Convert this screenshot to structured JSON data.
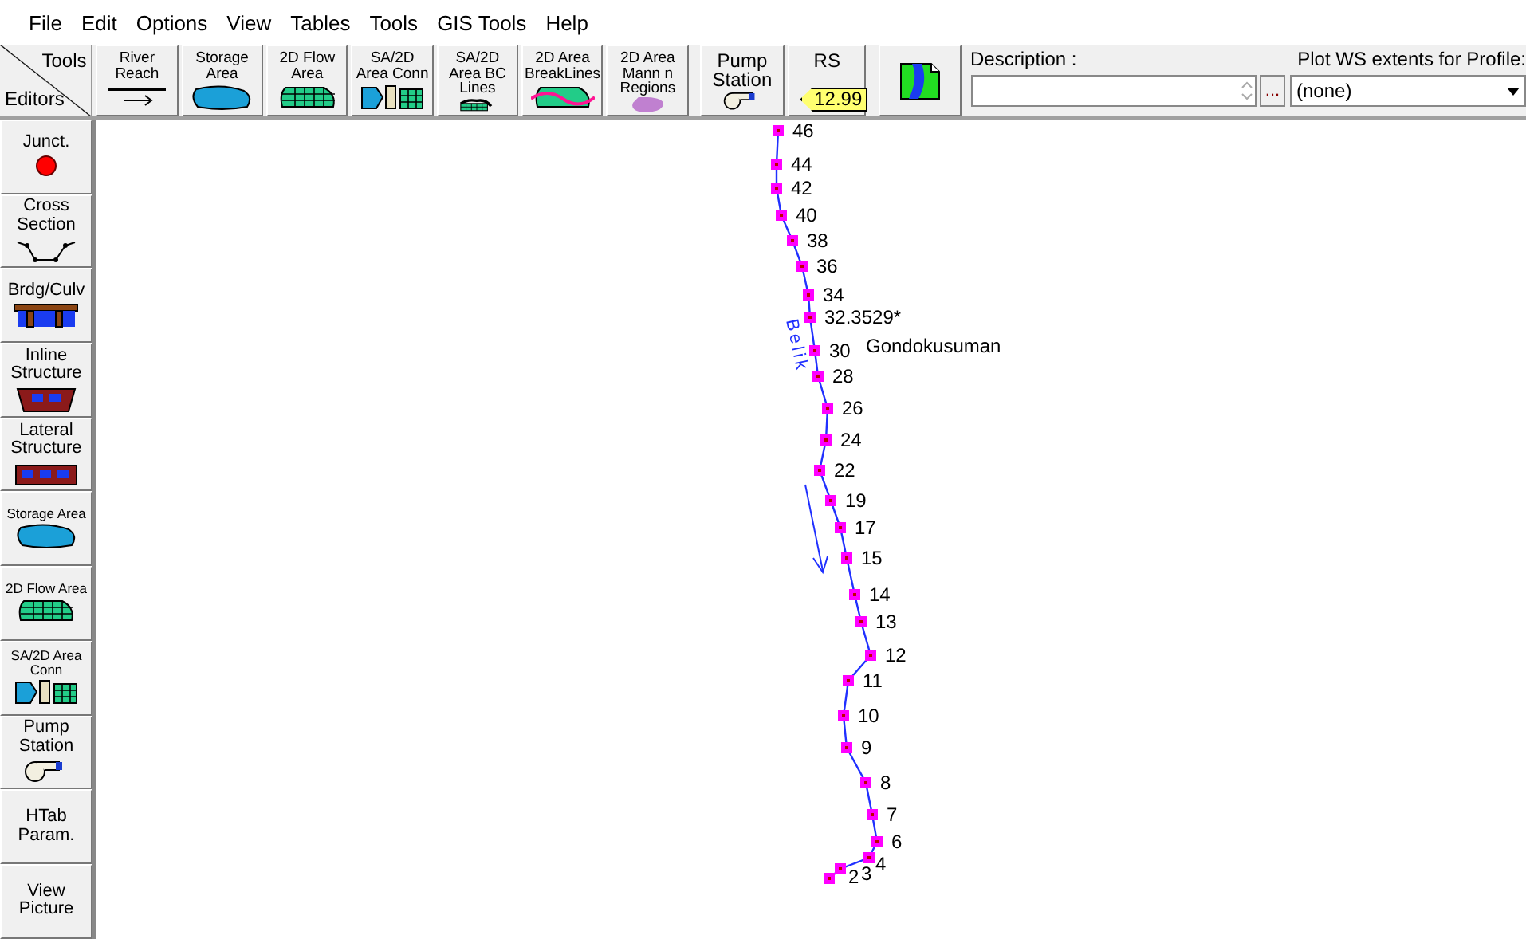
{
  "menu": [
    "File",
    "Edit",
    "Options",
    "View",
    "Tables",
    "Tools",
    "GIS Tools",
    "Help"
  ],
  "toolbar": {
    "corner_top": "Tools",
    "corner_bottom": "Editors",
    "tools": [
      {
        "label": "River Reach",
        "kind": "reach"
      },
      {
        "label": "Storage Area",
        "kind": "storage"
      },
      {
        "label": "2D Flow Area",
        "kind": "flow2d"
      },
      {
        "label": "SA/2D Area Conn",
        "kind": "conn"
      },
      {
        "label": "SA/2D Area BC Lines",
        "kind": "bclines"
      },
      {
        "label": "2D Area BreakLines",
        "kind": "breaklines"
      },
      {
        "label": "2D Area Mann n Regions",
        "kind": "mannn"
      }
    ],
    "pump": {
      "label": "Pump Station"
    },
    "rs": {
      "label": "RS",
      "value": "12.99"
    },
    "description": {
      "label": "Description :"
    },
    "browse": "...",
    "profile": {
      "label": "Plot WS extents for Profile:",
      "value": "(none)"
    }
  },
  "editors": [
    {
      "label": "Junct.",
      "kind": "junction"
    },
    {
      "label": "Cross Section",
      "kind": "xs"
    },
    {
      "label": "Brdg/Culv",
      "kind": "bridge"
    },
    {
      "label": "Inline Structure",
      "kind": "inline"
    },
    {
      "label": "Lateral Structure",
      "kind": "lateral"
    },
    {
      "label": "Storage Area",
      "kind": "storage"
    },
    {
      "label": "2D Flow Area",
      "kind": "flow2d"
    },
    {
      "label": "SA/2D Area Conn",
      "kind": "conn"
    },
    {
      "label": "Pump Station",
      "kind": "pump"
    },
    {
      "label": "HTab Param.",
      "kind": "none"
    },
    {
      "label": "View Picture",
      "kind": "none"
    }
  ],
  "schematic": {
    "river": "Belik",
    "reach": "Gondokusuman",
    "cross_sections": [
      {
        "label": "46"
      },
      {
        "label": "44"
      },
      {
        "label": "42"
      },
      {
        "label": "40"
      },
      {
        "label": "38"
      },
      {
        "label": "36"
      },
      {
        "label": "34"
      },
      {
        "label": "32.3529*"
      },
      {
        "label": "30"
      },
      {
        "label": "28"
      },
      {
        "label": "26"
      },
      {
        "label": "24"
      },
      {
        "label": "22"
      },
      {
        "label": "19"
      },
      {
        "label": "17"
      },
      {
        "label": "15"
      },
      {
        "label": "14"
      },
      {
        "label": "13"
      },
      {
        "label": "12"
      },
      {
        "label": "11"
      },
      {
        "label": "10"
      },
      {
        "label": "9"
      },
      {
        "label": "8"
      },
      {
        "label": "7"
      },
      {
        "label": "6"
      },
      {
        "label": "2"
      },
      {
        "label": "3"
      },
      {
        "label": "4"
      }
    ]
  }
}
